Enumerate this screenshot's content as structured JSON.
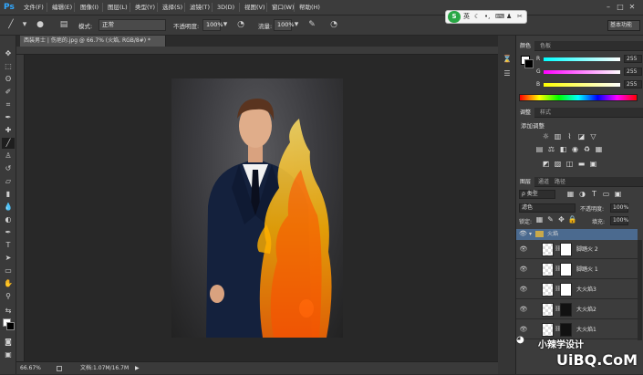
{
  "menubar": {
    "logo": "Ps",
    "items": [
      "文件(F)",
      "编辑(E)",
      "图像(I)",
      "图层(L)",
      "类型(Y)",
      "选择(S)",
      "滤镜(T)",
      "3D(D)",
      "视图(V)",
      "窗口(W)",
      "帮助(H)"
    ]
  },
  "options": {
    "mode_label": "模式:",
    "mode_value": "正常",
    "opacity_label": "不透明度:",
    "opacity_value": "100%",
    "flow_label": "流量:",
    "flow_value": "100%",
    "workspace": "基本功能"
  },
  "ime": {
    "logo": "S",
    "lang": "英"
  },
  "document": {
    "tab_title": "西装男士 | 伤疤的.jpg @ 66.7% (火焰, RGB/8#) *",
    "zoom": "66.67%",
    "doc_info": "文档:1.07M/16.7M"
  },
  "color_panel": {
    "tabs": [
      "颜色",
      "色板"
    ],
    "channels": [
      {
        "label": "R",
        "value": "255",
        "gradient": "linear-gradient(90deg,#00ffff,#ffffff)"
      },
      {
        "label": "G",
        "value": "255",
        "gradient": "linear-gradient(90deg,#ff00ff,#ffffff)"
      },
      {
        "label": "B",
        "value": "255",
        "gradient": "linear-gradient(90deg,#ffff00,#ffffff)"
      }
    ]
  },
  "adjust_panel": {
    "tabs": [
      "调整",
      "样式"
    ],
    "heading": "添加调整"
  },
  "layers_panel": {
    "tabs": [
      "图层",
      "通道",
      "路径"
    ],
    "filter_label": "ρ 类型",
    "blend_mode": "滤色",
    "opacity_label": "不透明度:",
    "opacity_value": "100%",
    "lock_label": "锁定:",
    "fill_label": "填充:",
    "fill_value": "100%",
    "group_name": "火焰",
    "layers": [
      {
        "name": "脚踏火 2"
      },
      {
        "name": "脚踏火 1"
      },
      {
        "name": "大火焰3"
      },
      {
        "name": "大火焰2"
      },
      {
        "name": "大火焰1"
      }
    ]
  },
  "watermark": {
    "brand": "UiBQ.CoM",
    "cn": "小辣学设计"
  },
  "colors": {
    "accent": "#31a8ff",
    "panel_bg": "#3c3c3c",
    "selected": "#4b6a8f"
  }
}
